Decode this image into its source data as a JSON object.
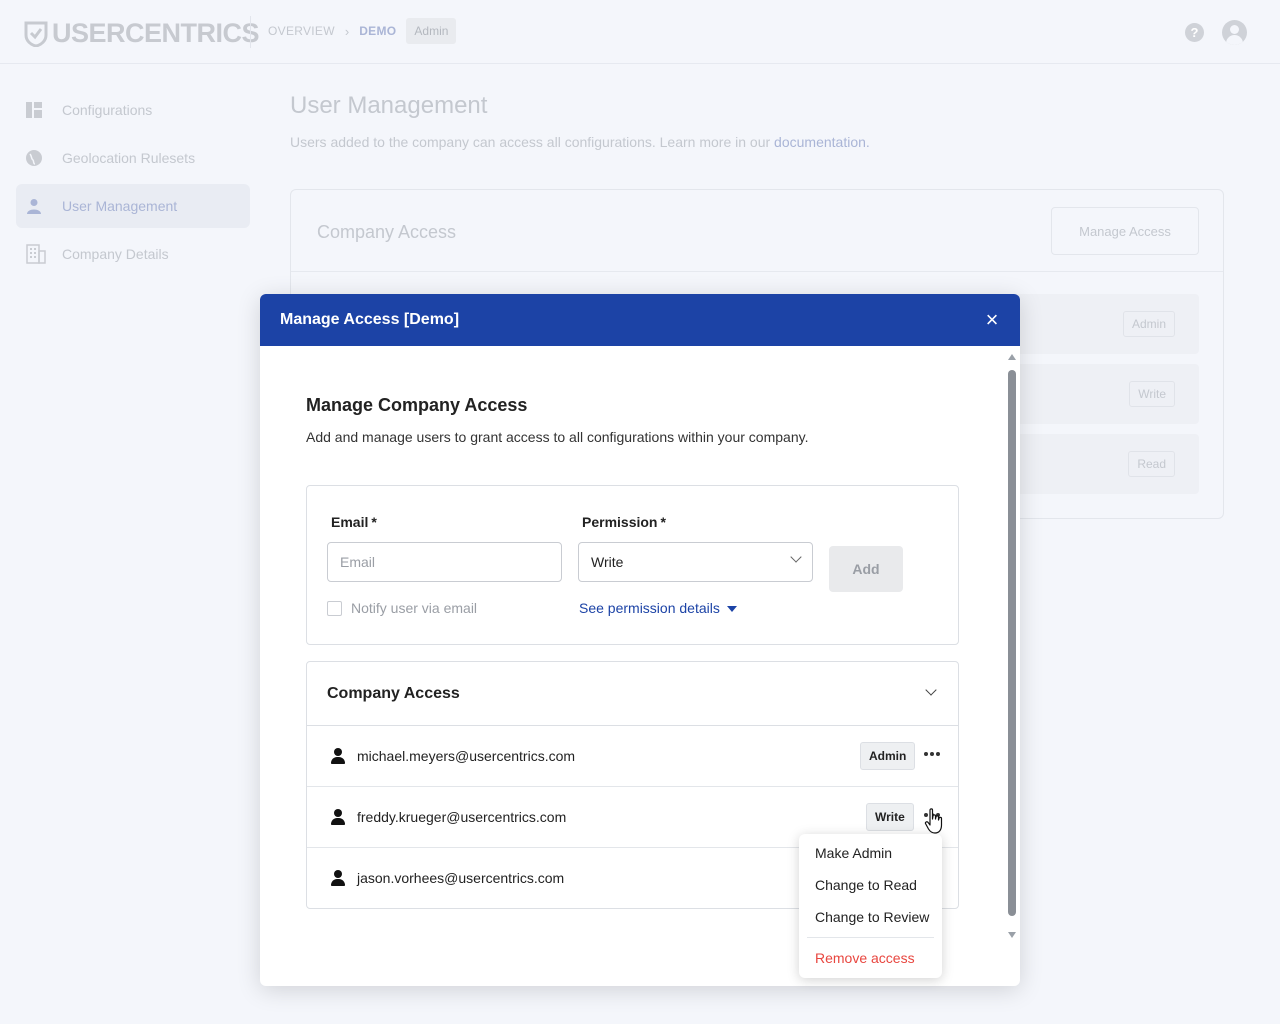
{
  "header": {
    "logo_text": "USERCENTRICS",
    "breadcrumb": {
      "overview": "OVERVIEW",
      "current": "DEMO",
      "badge": "Admin"
    }
  },
  "sidebar": {
    "items": [
      {
        "label": "Configurations",
        "icon": "dashboard-icon",
        "active": false
      },
      {
        "label": "Geolocation Rulesets",
        "icon": "globe-icon",
        "active": false
      },
      {
        "label": "User Management",
        "icon": "user-icon",
        "active": true
      },
      {
        "label": "Company Details",
        "icon": "building-icon",
        "active": false
      }
    ]
  },
  "page": {
    "title": "User Management",
    "description": "Users added to the company can access all configurations. Learn more in our ",
    "description_link": "documentation.",
    "card": {
      "title": "Company Access",
      "manage_button": "Manage Access",
      "roles": [
        "Admin",
        "Write",
        "Read"
      ]
    }
  },
  "modal": {
    "title": "Manage Access [Demo]",
    "section_title": "Manage Company Access",
    "section_desc": "Add and manage users to grant access to all configurations within your company.",
    "form": {
      "email_label": "Email",
      "email_placeholder": "Email",
      "email_value": "",
      "permission_label": "Permission",
      "permission_value": "Write",
      "required_mark": "*",
      "add_button": "Add",
      "notify_label": "Notify user via email",
      "notify_checked": false,
      "permission_details_link": "See permission details"
    },
    "access": {
      "title": "Company Access",
      "users": [
        {
          "email": "michael.meyers@usercentrics.com",
          "role": "Admin"
        },
        {
          "email": "freddy.krueger@usercentrics.com",
          "role": "Write"
        },
        {
          "email": "jason.vorhees@usercentrics.com",
          "role": ""
        }
      ]
    }
  },
  "menu": {
    "items": [
      "Make Admin",
      "Change to Read",
      "Change to Review"
    ],
    "danger_item": "Remove access"
  },
  "colors": {
    "brand_blue": "#1c43a6",
    "danger_red": "#e8463f"
  }
}
